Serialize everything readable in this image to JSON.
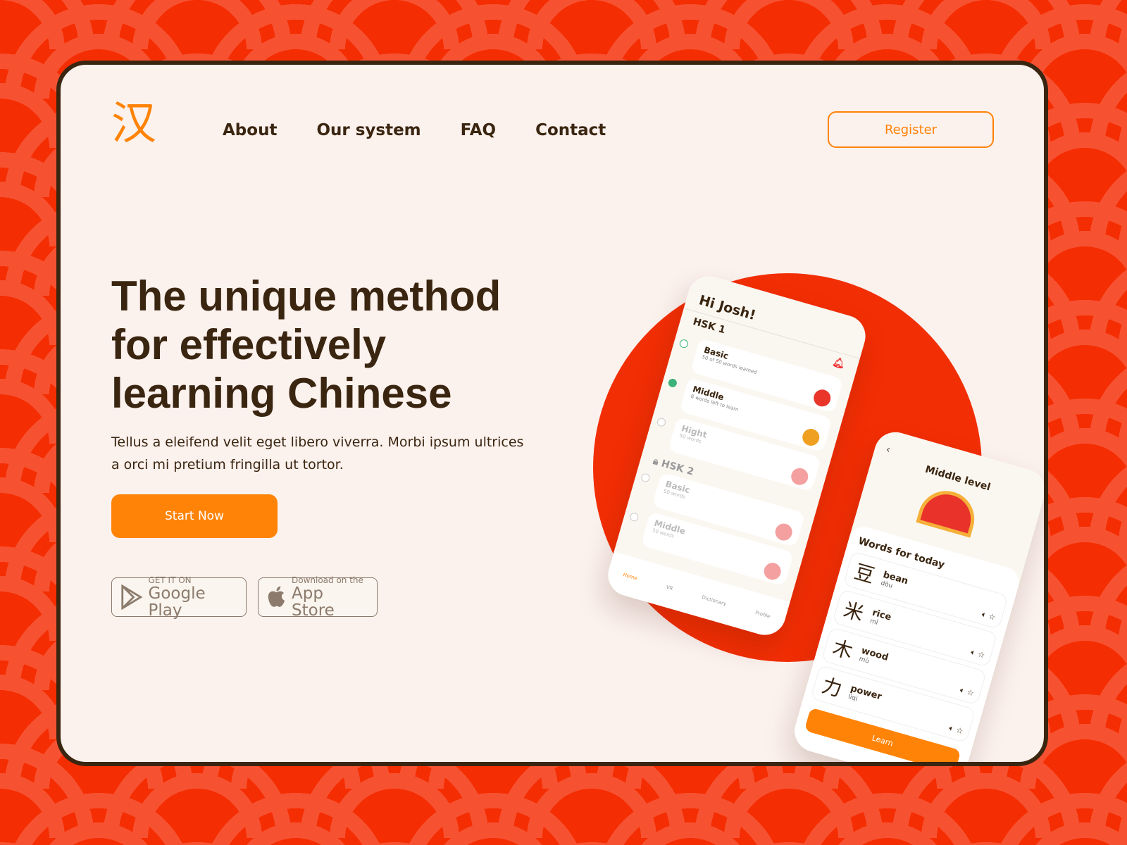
{
  "logo": "汉",
  "nav": [
    "About",
    "Our system",
    "FAQ",
    "Contact"
  ],
  "register": "Register",
  "hero": {
    "title": "The unique method for effectively learning Chinese",
    "subtitle": "Tellus a eleifend velit eget libero viverra. Morbi ipsum ultrices a orci mi pretium fringilla ut tortor.",
    "cta": "Start Now"
  },
  "stores": {
    "google_small": "GET IT ON",
    "google_big": "Google Play",
    "apple_small": "Download on the",
    "apple_big": "App Store"
  },
  "phone1": {
    "greeting": "Hi Josh!",
    "hsk1": "HSK 1",
    "hsk2": "HSK 2",
    "levels1": [
      {
        "t": "Basic",
        "d": "50 of 50 words learned"
      },
      {
        "t": "Middle",
        "d": "8 words left to learn"
      },
      {
        "t": "Hight",
        "d": "50 words"
      }
    ],
    "levels2": [
      {
        "t": "Basic",
        "d": "50 words"
      },
      {
        "t": "Middle",
        "d": "50 words"
      }
    ],
    "tabs": [
      "Home",
      "VR",
      "Dictionary",
      "Profile"
    ]
  },
  "phone2": {
    "title": "Middle level",
    "section": "Words for today",
    "learn": "Learn",
    "words": [
      {
        "h": "豆",
        "e": "bean",
        "p": "dòu"
      },
      {
        "h": "米",
        "e": "rice",
        "p": "mǐ"
      },
      {
        "h": "木",
        "e": "wood",
        "p": "mù"
      },
      {
        "h": "力",
        "e": "power",
        "p": "lìqi"
      }
    ]
  },
  "colors": {
    "accent": "#ff8307",
    "red": "#f52d02",
    "dark": "#3a2510"
  }
}
